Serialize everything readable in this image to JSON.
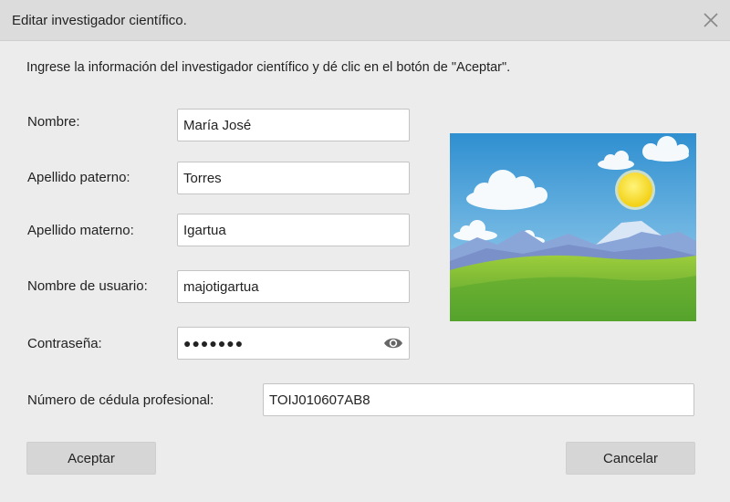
{
  "dialog": {
    "title": "Editar investigador científico.",
    "instructions": "Ingrese la información del investigador científico y dé clic en el botón de \"Aceptar\"."
  },
  "form": {
    "nombre_label": "Nombre:",
    "nombre_value": "María José",
    "apellido_paterno_label": "Apellido paterno:",
    "apellido_paterno_value": "Torres",
    "apellido_materno_label": "Apellido materno:",
    "apellido_materno_value": "Igartua",
    "usuario_label": "Nombre de usuario:",
    "usuario_value": "majotigartua",
    "password_label": "Contraseña:",
    "password_value": "●●●●●●●",
    "cedula_label": "Número de cédula profesional:",
    "cedula_value": "TOIJ010607AB8"
  },
  "buttons": {
    "accept": "Aceptar",
    "cancel": "Cancelar"
  },
  "icons": {
    "close": "close-icon",
    "show_password": "eye-icon",
    "image": "landscape-image"
  }
}
